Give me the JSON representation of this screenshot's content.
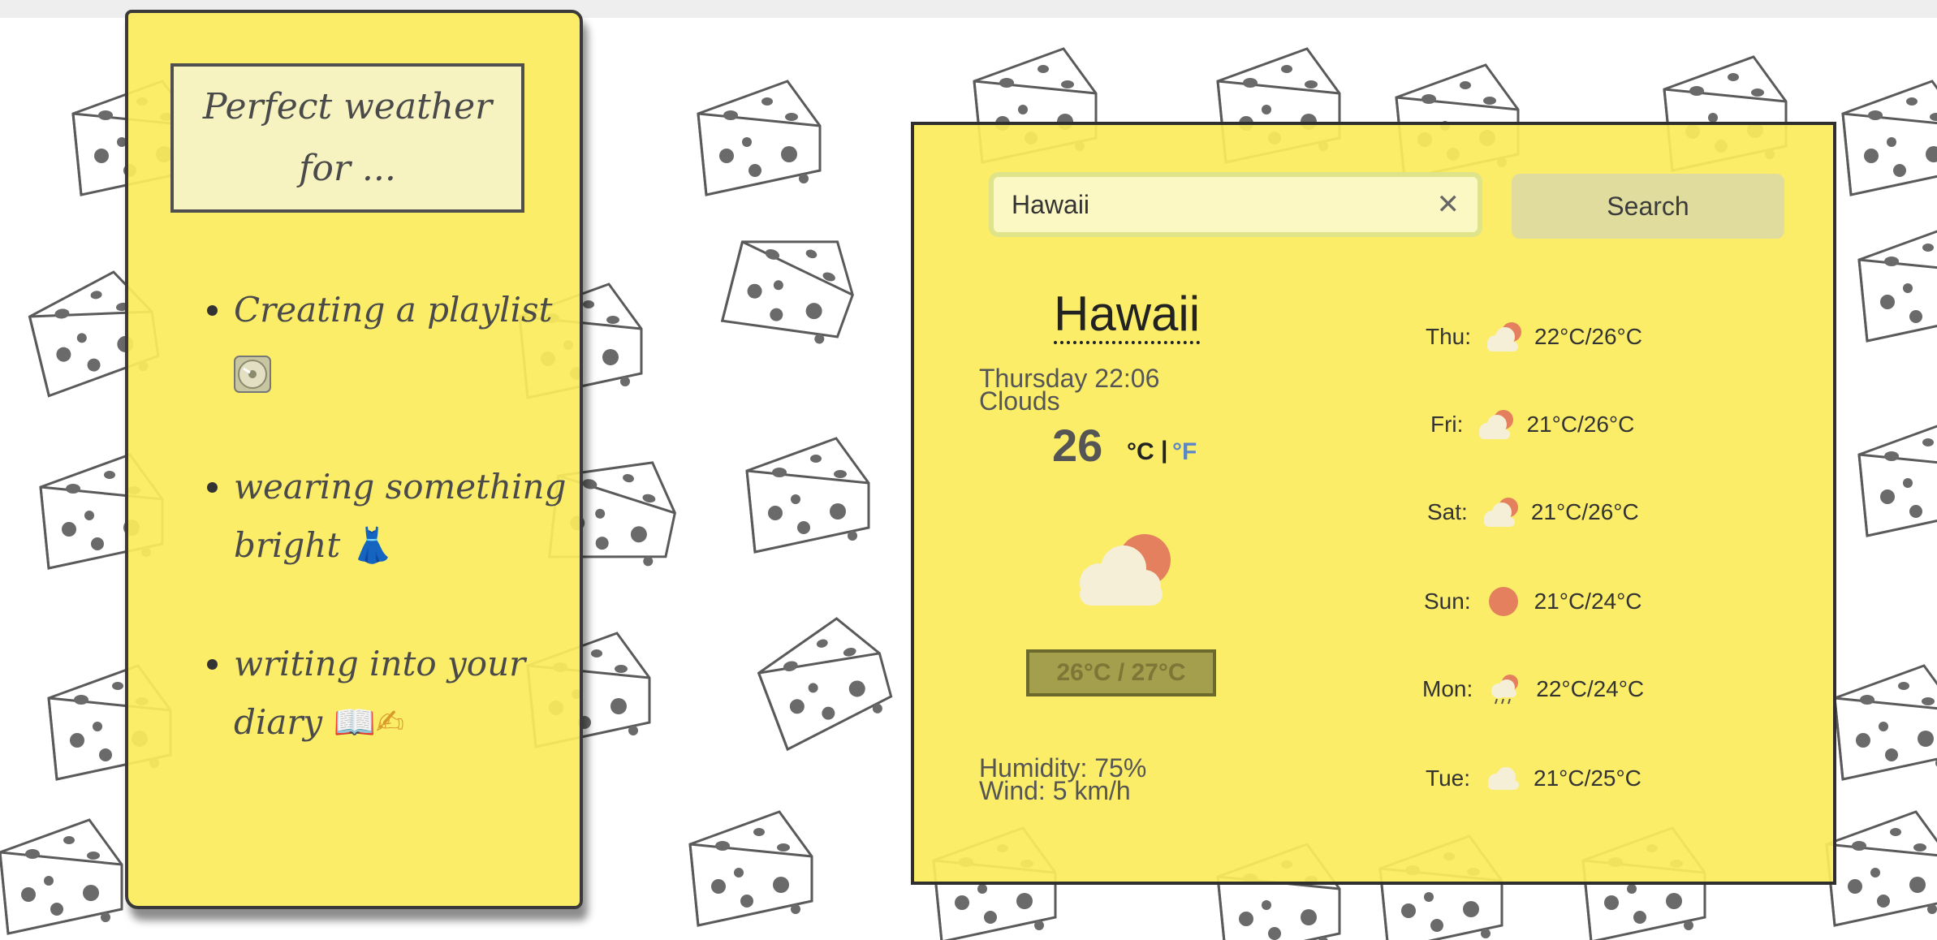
{
  "note": {
    "title": "Perfect weather for ...",
    "items": [
      {
        "text": "Creating a playlist",
        "emoji_icon": "cd-disc-icon"
      },
      {
        "text": "wearing something bright",
        "emoji": "👗"
      },
      {
        "text": "writing into your diary",
        "emoji": "📖✍"
      }
    ]
  },
  "search": {
    "value": "Hawaii",
    "clear_label": "✕",
    "button_label": "Search"
  },
  "current": {
    "city": "Hawaii",
    "datetime": "Thursday 22:06",
    "description": "Clouds",
    "temperature": "26",
    "unit_c": "°C",
    "unit_sep": "|",
    "unit_f": "°F",
    "icon": "sun-behind-cloud-icon",
    "range": "26°C / 27°C",
    "humidity": "Humidity: 75%",
    "wind": "Wind: 5 km/h"
  },
  "forecast": [
    {
      "day": "Thu:",
      "temps": "22°C/26°C",
      "icon": "sun-behind-cloud-icon"
    },
    {
      "day": "Fri:",
      "temps": "21°C/26°C",
      "icon": "sun-behind-cloud-icon"
    },
    {
      "day": "Sat:",
      "temps": "21°C/26°C",
      "icon": "sun-behind-cloud-icon"
    },
    {
      "day": "Sun:",
      "temps": "21°C/24°C",
      "icon": "sun-icon"
    },
    {
      "day": "Mon:",
      "temps": "22°C/24°C",
      "icon": "rain-cloud-sun-icon"
    },
    {
      "day": "Tue:",
      "temps": "21°C/25°C",
      "icon": "cloud-icon"
    }
  ],
  "colors": {
    "panel_yellow": "#fbec5c",
    "sun_orange": "#e5805f",
    "cloud_cream": "#f4efd6",
    "fahrenheit_link": "#5c86c7"
  }
}
